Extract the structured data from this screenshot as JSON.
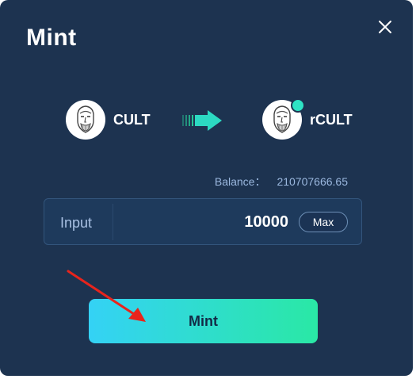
{
  "modal": {
    "title": "Mint",
    "close_icon": "close-icon"
  },
  "swap": {
    "from_token": {
      "symbol": "CULT",
      "icon": "cult-avatar-icon"
    },
    "to_token": {
      "symbol": "rCULT",
      "icon": "rcult-avatar-icon"
    },
    "arrow_icon": "arrow-right-icon"
  },
  "balance": {
    "label": "Balance：",
    "value": "210707666.65"
  },
  "input": {
    "label": "Input",
    "value": "10000",
    "max_label": "Max"
  },
  "action": {
    "mint_label": "Mint"
  },
  "colors": {
    "background": "#1d3350",
    "accent_start": "#34d2f5",
    "accent_end": "#2ae8a5",
    "pointer": "#e8241c"
  }
}
